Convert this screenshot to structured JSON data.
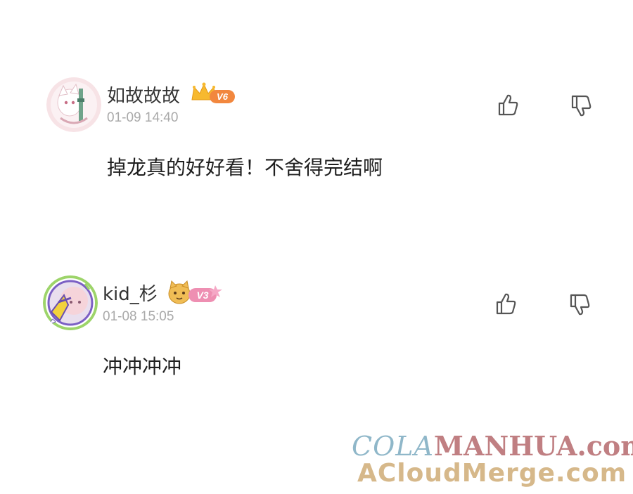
{
  "comments": [
    {
      "username": "如故故故",
      "level": "V6",
      "timestamp": "01-09 14:40",
      "text": "掉龙真的好好看！不舍得完结啊",
      "avatar_icon": "anime-avatar-icon",
      "badge_icon": "crown-icon",
      "badge_color": "#f5a623",
      "level_color": "#f08a3c"
    },
    {
      "username": "kid_杉",
      "level": "V3",
      "timestamp": "01-08 15:05",
      "text": "冲冲冲冲",
      "avatar_icon": "anime-avatar-icon",
      "badge_icon": "cat-face-icon",
      "badge_color": "#e8b04a",
      "level_color": "#ef8fb0"
    }
  ],
  "actions": {
    "like_icon": "thumbs-up-icon",
    "dislike_icon": "thumbs-down-icon"
  },
  "watermark": {
    "line1_part_a": "COLA",
    "line1_part_b": "MANHUA.com",
    "line2": "ACloudMerge.com"
  }
}
